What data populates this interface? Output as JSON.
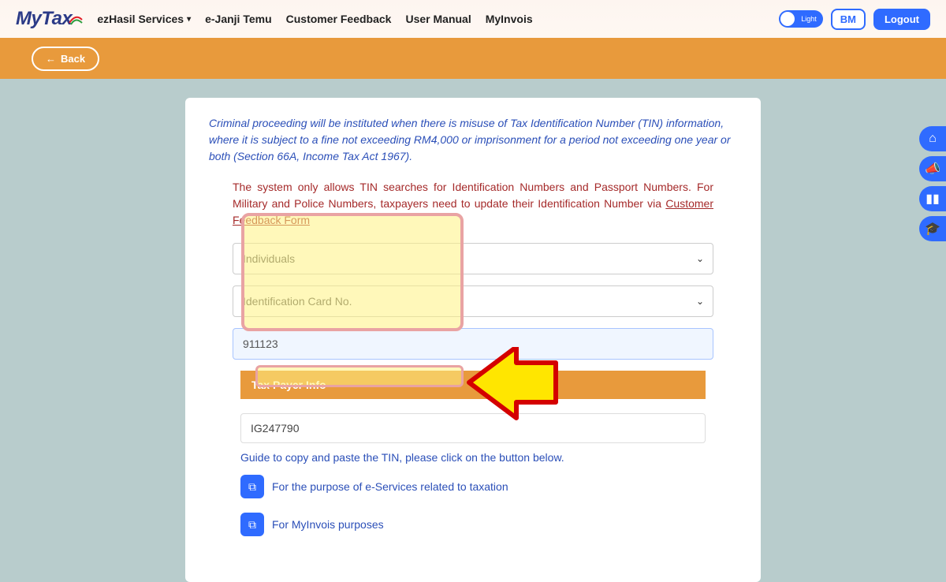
{
  "header": {
    "logo_my": "My",
    "logo_tax": "Tax",
    "nav": {
      "ezhasil": "ezHasil Services",
      "ejanji": "e-Janji Temu",
      "feedback": "Customer Feedback",
      "manual": "User Manual",
      "myinvois": "MyInvois"
    },
    "toggle_label": "Light",
    "bm": "BM",
    "logout": "Logout"
  },
  "back": "Back",
  "warning": "Criminal proceeding will be instituted when there is misuse of Tax Identification Number (TIN) information, where it is subject to a fine not exceeding RM4,000 or imprisonment for a period not exceeding one year or both (Section 66A, Income Tax Act 1967).",
  "info": {
    "text": "The system only allows TIN searches for Identification Numbers and Passport Numbers. For Military and Police Numbers, taxpayers need to update their Identification Number via ",
    "link": "Customer Feedback Form"
  },
  "form": {
    "type": "Individuals",
    "id_type": "Identification Card No.",
    "id_value": "911123"
  },
  "taxpayer": {
    "section": "Tax Payer Info",
    "tin": "IG247790",
    "guide": "Guide to copy and paste the TIN, please click on the button below.",
    "copy1": "For the purpose of e-Services related to taxation",
    "copy2": "For MyInvois purposes"
  }
}
